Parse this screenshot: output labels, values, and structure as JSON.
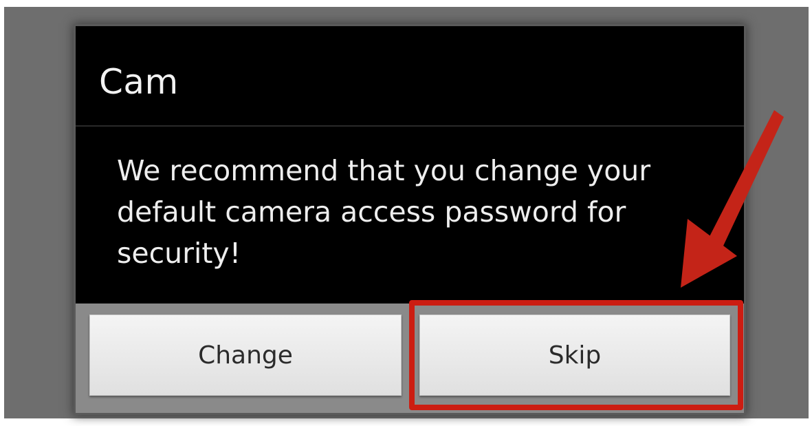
{
  "dialog": {
    "title": "Cam",
    "message": "We recommend that you change your default camera access password for security!",
    "buttons": {
      "change_label": "Change",
      "skip_label": "Skip"
    }
  },
  "annotation": {
    "highlight_color": "#cc1d12",
    "arrow_icon": "arrow-down-left-icon"
  }
}
